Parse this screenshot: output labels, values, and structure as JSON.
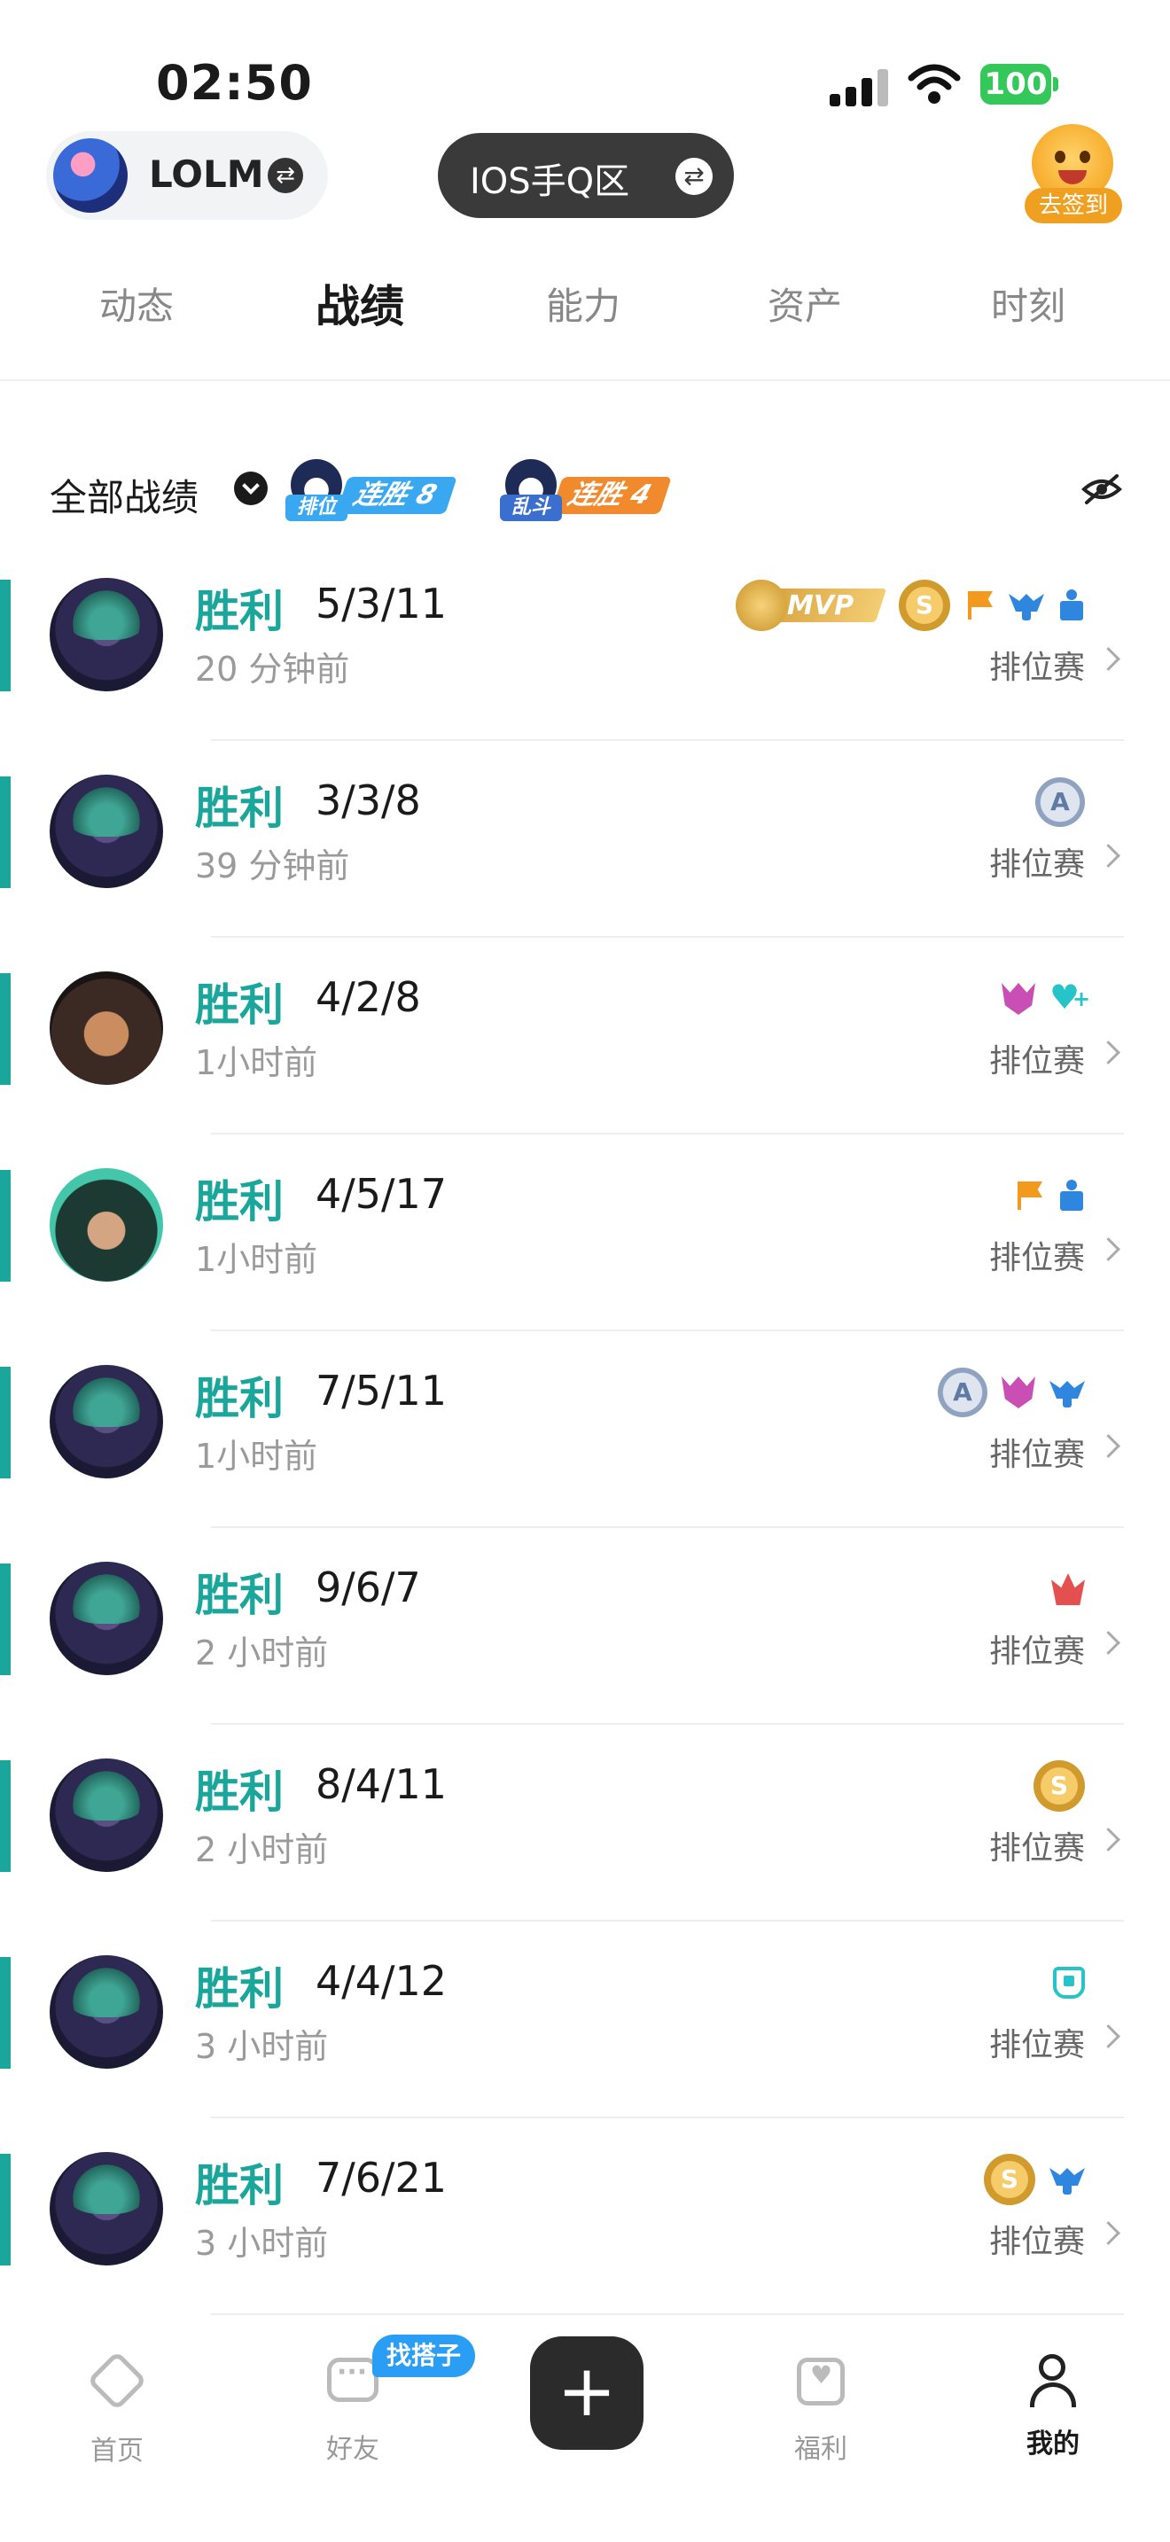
{
  "status_bar": {
    "time": "02:50",
    "battery": "100"
  },
  "header": {
    "account_name": "LOLM",
    "region_label": "IOS手Q区",
    "signin_label": "去签到"
  },
  "tabs": [
    {
      "label": "动态"
    },
    {
      "label": "战绩"
    },
    {
      "label": "能力"
    },
    {
      "label": "资产"
    },
    {
      "label": "时刻"
    }
  ],
  "active_tab": "战绩",
  "filter": {
    "label": "全部战绩",
    "streaks": [
      {
        "mode": "排位",
        "text": "连胜 8",
        "color": "#3aa8f0"
      },
      {
        "mode": "乱斗",
        "text": "连胜 4",
        "color": "#f08a2c"
      }
    ]
  },
  "matches": [
    {
      "result": "胜利",
      "kda": "5/3/11",
      "time": "20 分钟前",
      "mode": "排位赛",
      "portrait": "a",
      "badges": [
        "mvp-badge",
        "s-coin-badge",
        "flag-icon",
        "wing-icon",
        "trophy-icon"
      ]
    },
    {
      "result": "胜利",
      "kda": "3/3/8",
      "time": "39 分钟前",
      "mode": "排位赛",
      "portrait": "a",
      "badges": [
        "a-rank-badge"
      ]
    },
    {
      "result": "胜利",
      "kda": "4/2/8",
      "time": "1小时前",
      "mode": "排位赛",
      "portrait": "b",
      "badges": [
        "demon-icon",
        "heart-plus-icon"
      ]
    },
    {
      "result": "胜利",
      "kda": "4/5/17",
      "time": "1小时前",
      "mode": "排位赛",
      "portrait": "c",
      "badges": [
        "flag-icon",
        "trophy-icon"
      ]
    },
    {
      "result": "胜利",
      "kda": "7/5/11",
      "time": "1小时前",
      "mode": "排位赛",
      "portrait": "a",
      "badges": [
        "a-rank-badge",
        "demon-icon",
        "wing-icon"
      ]
    },
    {
      "result": "胜利",
      "kda": "9/6/7",
      "time": "2 小时前",
      "mode": "排位赛",
      "portrait": "a",
      "badges": [
        "crown-icon"
      ]
    },
    {
      "result": "胜利",
      "kda": "8/4/11",
      "time": "2 小时前",
      "mode": "排位赛",
      "portrait": "a",
      "badges": [
        "s-coin-badge"
      ]
    },
    {
      "result": "胜利",
      "kda": "4/4/12",
      "time": "3 小时前",
      "mode": "排位赛",
      "portrait": "a",
      "badges": [
        "shield-icon"
      ]
    },
    {
      "result": "胜利",
      "kda": "7/6/21",
      "time": "3 小时前",
      "mode": "排位赛",
      "portrait": "a",
      "badges": [
        "s-coin-badge",
        "wing-icon"
      ]
    }
  ],
  "badge_text": {
    "mvp": "MVP",
    "s": "S",
    "a": "A"
  },
  "bottom_nav": {
    "items": [
      {
        "label": "首页"
      },
      {
        "label": "好友"
      },
      {
        "label": "福利"
      },
      {
        "label": "我的"
      }
    ],
    "partner_badge": "找搭子",
    "plus": "+"
  },
  "colors": {
    "accent": "#1aa69a",
    "win": "#1aa69a"
  }
}
